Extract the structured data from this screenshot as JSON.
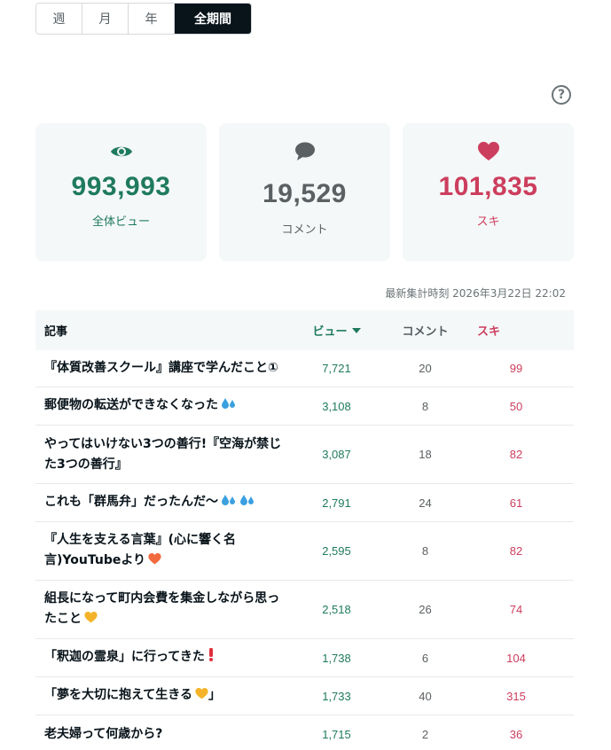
{
  "tabs": [
    {
      "label": "週",
      "active": false
    },
    {
      "label": "月",
      "active": false
    },
    {
      "label": "年",
      "active": false
    },
    {
      "label": "全期間",
      "active": true
    }
  ],
  "help": {
    "label": "?"
  },
  "stats": {
    "views": {
      "value": "993,993",
      "label": "全体ビュー",
      "icon": "eye-icon",
      "color": "#1f7a5e"
    },
    "comments": {
      "value": "19,529",
      "label": "コメント",
      "icon": "speech-bubble-icon",
      "color": "#5b6063"
    },
    "likes": {
      "value": "101,835",
      "label": "スキ",
      "icon": "heart-icon",
      "color": "#cc3e5e"
    }
  },
  "updated": "最新集計時刻 2026年3月22日 22:02",
  "table": {
    "headers": {
      "title": "記事",
      "views": "ビュー",
      "comments": "コメント",
      "likes": "スキ"
    },
    "rows": [
      {
        "title": "『体質改善スクール』講座で学んだこと①",
        "views": "7,721",
        "comments": "20",
        "likes": "99",
        "emoji": ""
      },
      {
        "title": "郵便物の転送ができなくなった",
        "views": "3,108",
        "comments": "8",
        "likes": "50",
        "emoji": "sweat-drops-icon"
      },
      {
        "title": "やってはいけない3つの善行!『空海が禁じた3つの善行』",
        "views": "3,087",
        "comments": "18",
        "likes": "82",
        "emoji": ""
      },
      {
        "title": "これも「群馬弁」だったんだ〜",
        "views": "2,791",
        "comments": "24",
        "likes": "61",
        "emoji": "sweat-drops-icon-x2"
      },
      {
        "title": "『人生を支える言葉』(心に響く名言)YouTubeより",
        "views": "2,595",
        "comments": "8",
        "likes": "82",
        "emoji": "orange-heart-icon"
      },
      {
        "title": "組長になって町内会費を集金しながら思ったこと",
        "views": "2,518",
        "comments": "26",
        "likes": "74",
        "emoji": "yellow-heart-icon"
      },
      {
        "title": "「釈迦の霊泉」に行ってきた",
        "views": "1,738",
        "comments": "6",
        "likes": "104",
        "emoji": "exclamation-icon"
      },
      {
        "title": "「夢を大切に抱えて生きる」",
        "views": "1,733",
        "comments": "40",
        "likes": "315",
        "emoji": "yellow-heart-icon-inline"
      },
      {
        "title": "老夫婦って何歳から?",
        "views": "1,715",
        "comments": "2",
        "likes": "36",
        "emoji": ""
      }
    ]
  }
}
